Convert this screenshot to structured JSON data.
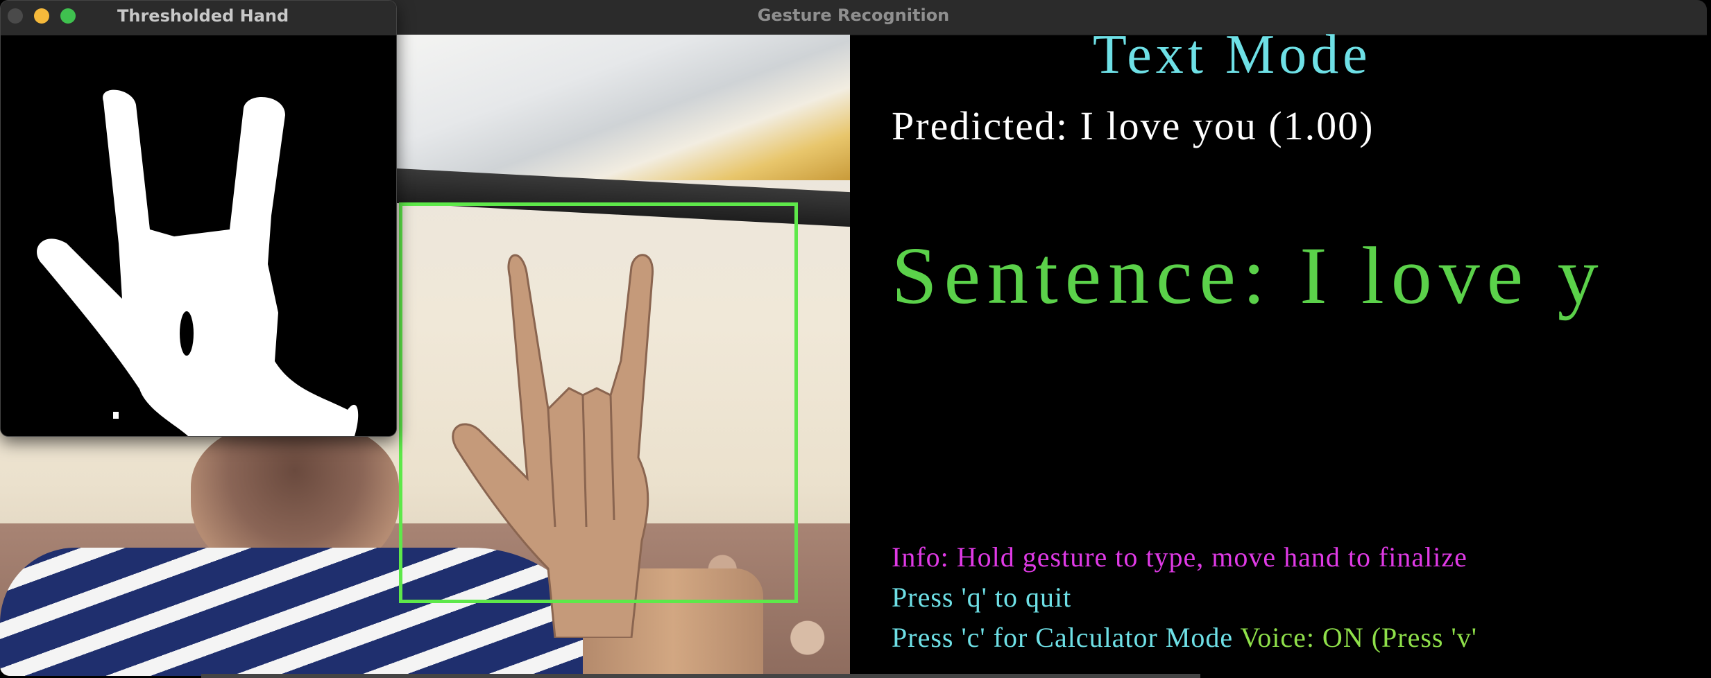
{
  "main_window": {
    "title": "Gesture Recognition"
  },
  "threshold_window": {
    "title": "Thresholded Hand",
    "traffic_lights": {
      "close_color": "#4a4a4a",
      "minimize_color": "#f5b93b",
      "zoom_color": "#3fc14f"
    }
  },
  "overlay": {
    "mode_title": "Text Mode",
    "predicted": "Predicted: I love you (1.00)",
    "sentence": "Sentence: I love y",
    "info": "Info: Hold gesture to type, move hand to finalize",
    "quit_hint": "Press 'q' to quit",
    "calc_hint": "Press 'c' for Calculator Mode",
    "voice": "Voice: ON (Press 'v'"
  },
  "colors": {
    "mode_title": "#6ee0e6",
    "sentence": "#5bd14a",
    "info": "#e03ae6",
    "detection_box": "#5ee84a"
  }
}
